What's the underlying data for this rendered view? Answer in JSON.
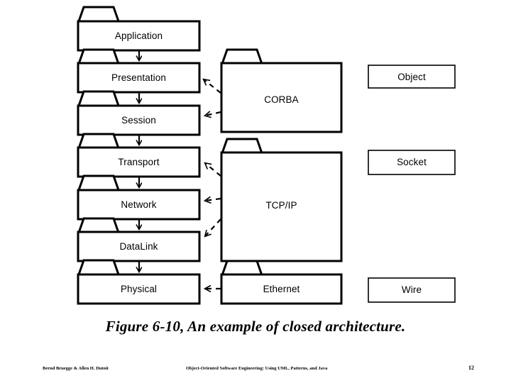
{
  "slide": {
    "caption": "Figure 6-10, An example of closed architecture.",
    "footer": {
      "authors": "Bernd Bruegge & Allen H. Dutoit",
      "book_title": "Object-Oriented Software Engineering: Using UML, Patterns, and Java",
      "page_number": "12"
    }
  },
  "diagram": {
    "type": "uml-package-layer-diagram",
    "stroke_color": "#000000",
    "fill_color": "#ffffff",
    "osi_stack": {
      "shape": "package-folder",
      "layers": [
        {
          "label": "Application"
        },
        {
          "label": "Presentation"
        },
        {
          "label": "Session"
        },
        {
          "label": "Transport"
        },
        {
          "label": "Network"
        },
        {
          "label": "DataLink"
        },
        {
          "label": "Physical"
        }
      ]
    },
    "middle_column": {
      "shape": "package-folder",
      "nodes": [
        {
          "label": "CORBA"
        },
        {
          "label": "TCP/IP"
        },
        {
          "label": "Ethernet"
        }
      ]
    },
    "right_column": {
      "shape": "rectangle",
      "nodes": [
        {
          "label": "Object"
        },
        {
          "label": "Socket"
        },
        {
          "label": "Wire"
        }
      ]
    },
    "connectors": {
      "stack_arrows": {
        "style": "solid",
        "head": "open-arrow",
        "direction": "downward",
        "count": 6
      },
      "dependency_arrows": {
        "style": "dashed",
        "head": "open-arrow",
        "count": 5,
        "edges": [
          {
            "from": "CORBA",
            "to": "Presentation"
          },
          {
            "from": "CORBA",
            "to": "Session"
          },
          {
            "from": "TCP/IP",
            "to": "Transport"
          },
          {
            "from": "TCP/IP",
            "to": "Network"
          },
          {
            "from": "TCP/IP",
            "to": "DataLink"
          },
          {
            "from": "Ethernet",
            "to": "Physical"
          }
        ]
      }
    }
  }
}
